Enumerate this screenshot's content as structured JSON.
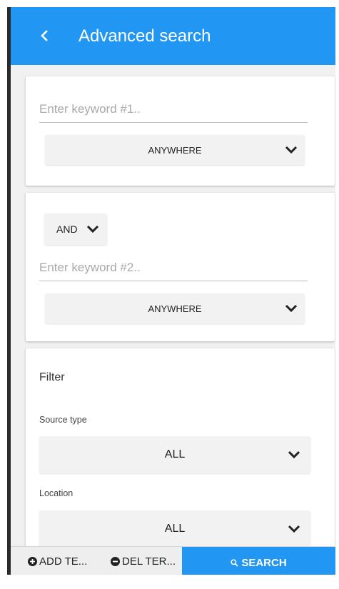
{
  "header": {
    "title": "Advanced search",
    "background": "#2196f3"
  },
  "keyword1": {
    "placeholder": "Enter keyword #1..",
    "value": "",
    "position_select": "ANYWHERE"
  },
  "keyword2": {
    "operator": "AND",
    "placeholder": "Enter keyword #2..",
    "value": "",
    "position_select": "ANYWHERE"
  },
  "filter": {
    "heading": "Filter",
    "source_type_label": "Source type",
    "source_type_value": "ALL",
    "location_label": "Location",
    "location_value": "ALL"
  },
  "footer": {
    "add_term_label": "ADD TE...",
    "del_term_label": "DEL TER...",
    "search_label": "SEARCH"
  },
  "icons": {
    "back": "chevron-left-icon",
    "dropdown": "chevron-down-icon",
    "add": "plus-circle-icon",
    "remove": "minus-circle-icon",
    "search": "search-icon"
  },
  "colors": {
    "accent": "#2196f3",
    "frame": "#2b2b2b",
    "app_background": "#f1f1f1"
  }
}
